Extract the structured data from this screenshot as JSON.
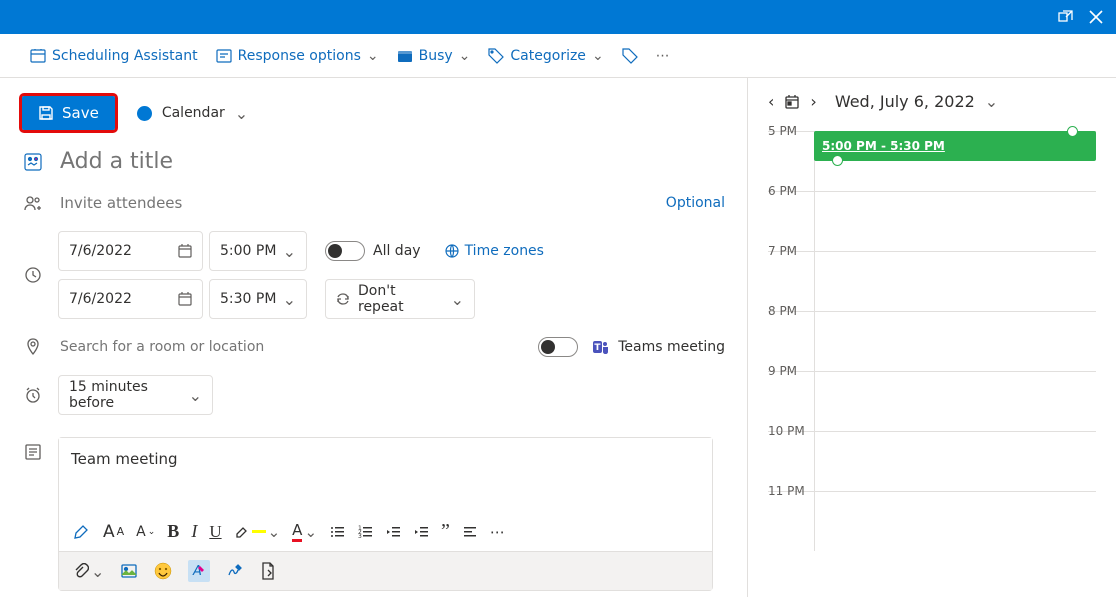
{
  "titlebar": {},
  "commands": {
    "scheduling_assistant": "Scheduling Assistant",
    "response_options": "Response options",
    "busy": "Busy",
    "categorize": "Categorize"
  },
  "form": {
    "save": "Save",
    "calendar_name": "Calendar",
    "title_placeholder": "Add a title",
    "title_value": "",
    "attendees_placeholder": "Invite attendees",
    "optional": "Optional",
    "start_date": "7/6/2022",
    "start_time": "5:00 PM",
    "end_date": "7/6/2022",
    "end_time": "5:30 PM",
    "all_day": "All day",
    "time_zones": "Time zones",
    "repeat": "Don't repeat",
    "location_placeholder": "Search for a room or location",
    "teams_meeting": "Teams meeting",
    "reminder": "15 minutes before",
    "description": "Team meeting"
  },
  "calendar": {
    "date_label": "Wed, July 6, 2022",
    "hours": [
      "5 PM",
      "6 PM",
      "7 PM",
      "8 PM",
      "9 PM",
      "10 PM",
      "11 PM"
    ],
    "event": {
      "label": "5:00 PM - 5:30 PM"
    }
  }
}
